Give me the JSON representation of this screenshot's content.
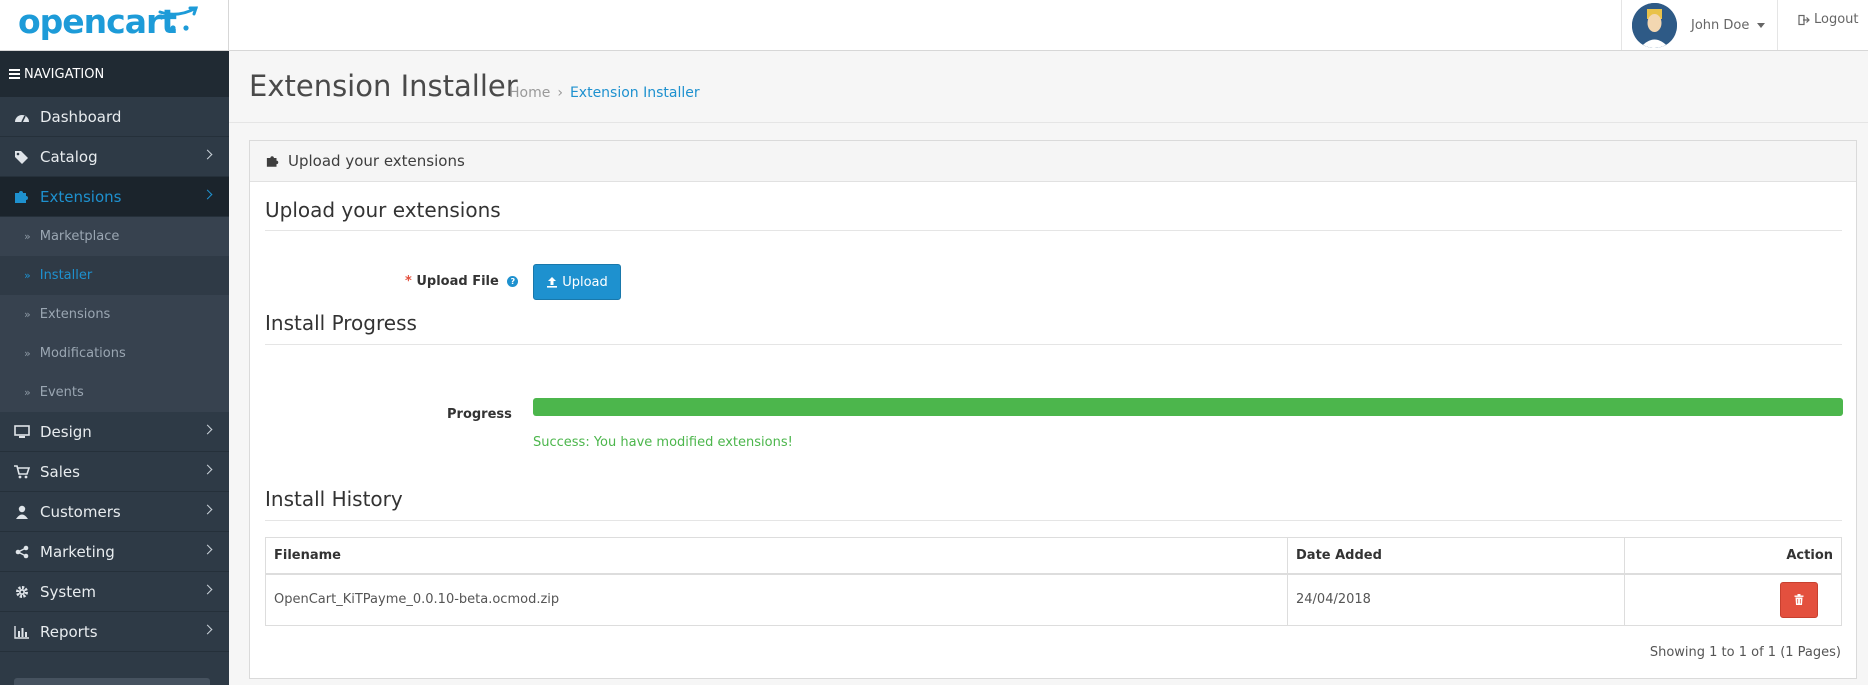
{
  "header": {
    "logo_text": "opencart",
    "user_name": "John Doe",
    "logout_label": "Logout"
  },
  "sidebar": {
    "heading": "NAVIGATION",
    "items": [
      {
        "label": "Dashboard",
        "icon": "dashboard-icon"
      },
      {
        "label": "Catalog",
        "icon": "tags-icon"
      },
      {
        "label": "Extensions",
        "icon": "puzzle-icon",
        "active": true
      },
      {
        "label": "Design",
        "icon": "desktop-icon"
      },
      {
        "label": "Sales",
        "icon": "cart-icon"
      },
      {
        "label": "Customers",
        "icon": "user-icon"
      },
      {
        "label": "Marketing",
        "icon": "share-icon"
      },
      {
        "label": "System",
        "icon": "gear-icon"
      },
      {
        "label": "Reports",
        "icon": "bar-chart-icon"
      }
    ],
    "extensions_sub": [
      {
        "label": "Marketplace"
      },
      {
        "label": "Installer",
        "active": true
      },
      {
        "label": "Extensions"
      },
      {
        "label": "Modifications"
      },
      {
        "label": "Events"
      }
    ]
  },
  "page": {
    "title": "Extension Installer",
    "breadcrumb": [
      "Home",
      "Extension Installer"
    ],
    "breadcrumb_sep": "›"
  },
  "panel": {
    "heading": "Upload your extensions",
    "upload_section": "Upload your extensions",
    "upload_label": "Upload File",
    "required_mark": "*",
    "upload_button": "Upload",
    "progress_section": "Install Progress",
    "progress_label": "Progress",
    "progress_fraction": 1.0,
    "success_message": "Success: You have modified extensions!",
    "history_section": "Install History",
    "table": {
      "columns": [
        "Filename",
        "Date Added",
        "Action"
      ],
      "rows": [
        {
          "filename": "OpenCart_KiTPayme_0.0.10-beta.ocmod.zip",
          "date": "24/04/2018"
        }
      ]
    },
    "pagination": "Showing 1 to 1 of 1 (1 Pages)"
  },
  "colors": {
    "accent": "#1e91cf",
    "success": "#4cb64c",
    "danger": "#e3503e",
    "sidebar_bg": "#2e3a46"
  }
}
